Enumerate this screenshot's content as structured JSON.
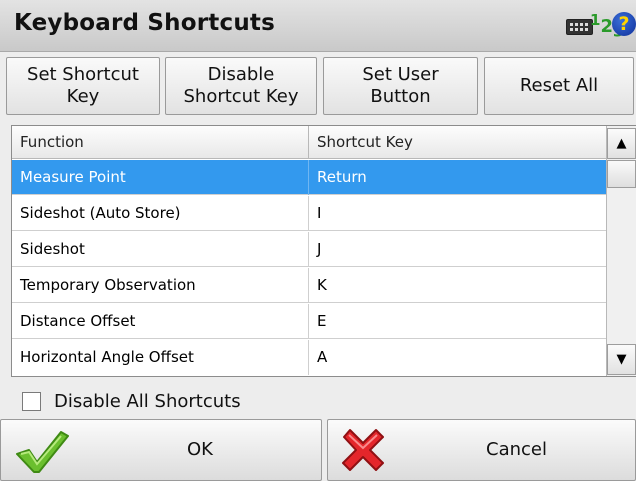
{
  "window": {
    "title": "Keyboard Shortcuts",
    "icons": [
      "keyboard-icon",
      "input-mode-123-icon",
      "help-icon"
    ],
    "input_mode_text": [
      "1",
      "2",
      "3"
    ],
    "help_glyph": "?"
  },
  "toolbar": {
    "set_shortcut_label": "Set Shortcut\nKey",
    "disable_shortcut_label": "Disable\nShortcut Key",
    "set_user_button_label": "Set User\nButton",
    "reset_all_label": "Reset All"
  },
  "table": {
    "columns": [
      "Function",
      "Shortcut Key"
    ],
    "rows": [
      {
        "function": "Measure Point",
        "key": "Return",
        "selected": true
      },
      {
        "function": "Sideshot (Auto Store)",
        "key": "I"
      },
      {
        "function": "Sideshot",
        "key": "J"
      },
      {
        "function": "Temporary Observation",
        "key": "K"
      },
      {
        "function": "Distance Offset",
        "key": "E"
      },
      {
        "function": "Horizontal Angle Offset",
        "key": "A"
      }
    ],
    "selection_color": "#3399ee"
  },
  "options": {
    "disable_all_label": "Disable All Shortcuts",
    "disable_all_checked": false
  },
  "footer": {
    "ok_label": "OK",
    "cancel_label": "Cancel",
    "ok_icon": "green-check-icon",
    "cancel_icon": "red-x-icon"
  }
}
